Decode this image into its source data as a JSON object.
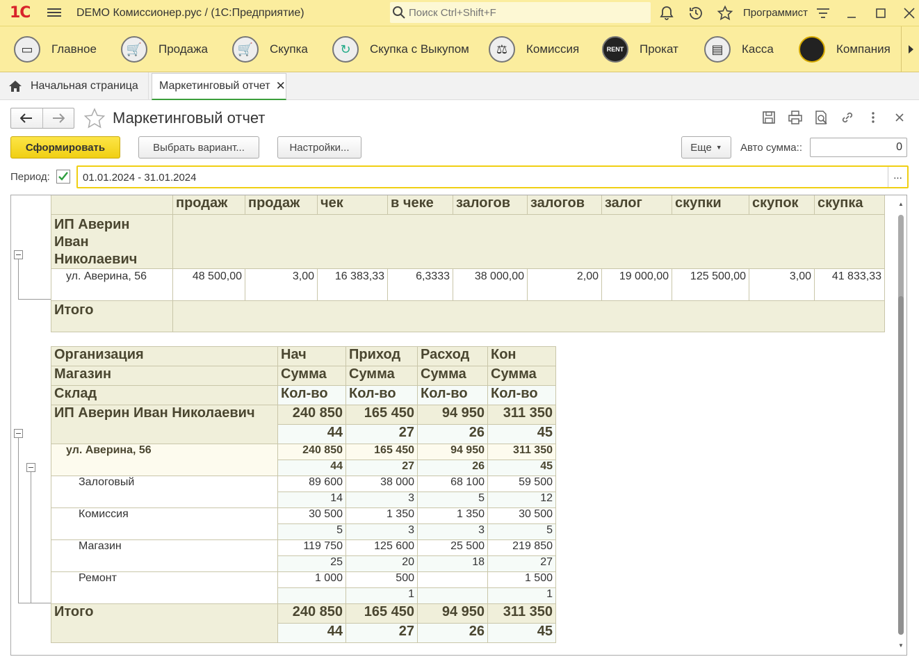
{
  "titlebar": {
    "logo": "1С",
    "app_title": "DEMO Комиссионер.рус /   (1С:Предприятие)",
    "search_placeholder": "Поиск Ctrl+Shift+F",
    "user": "Программист"
  },
  "sections": [
    {
      "label": "Главное",
      "icon": "main-icon"
    },
    {
      "label": "Продажа",
      "icon": "sale-cart-icon"
    },
    {
      "label": "Скупка",
      "icon": "purchase-cart-icon"
    },
    {
      "label": "Скупка с Выкупом",
      "icon": "buyback-arrows-icon"
    },
    {
      "label": "Комиссия",
      "icon": "scales-icon"
    },
    {
      "label": "Прокат",
      "icon": "rent-icon"
    },
    {
      "label": "Касса",
      "icon": "cash-register-icon"
    },
    {
      "label": "Компания",
      "icon": "company-logo-icon"
    }
  ],
  "tabs": {
    "home": "Начальная страница",
    "report": "Маркетинговый отчет"
  },
  "form": {
    "title": "Маркетинговый отчет",
    "generate": "Сформировать",
    "choose_variant": "Выбрать вариант...",
    "settings": "Настройки...",
    "more": "Еще",
    "auto_sum_label": "Авто сумма::",
    "auto_sum_value": "0",
    "period_label": "Период:",
    "period_value": "01.01.2024 - 31.01.2024",
    "period_dots": "..."
  },
  "table1": {
    "headers": [
      "продаж",
      "продаж",
      "чек",
      "в чеке",
      "залогов",
      "залогов",
      "залог",
      "скупки",
      "скупок",
      "скупка"
    ],
    "org_line1": "ИП Аверин",
    "org_line2": "Иван",
    "org_line3": "Николаевич",
    "store": "ул. Аверина, 56",
    "row": [
      "48 500,00",
      "3,00",
      "16 383,33",
      "6,3333",
      "38 000,00",
      "2,00",
      "19 000,00",
      "125 500,00",
      "3,00",
      "41 833,33"
    ],
    "total_label": "Итого"
  },
  "table2": {
    "h_org": "Организация",
    "h_store": "Магазин",
    "h_wh": "Склад",
    "h_cols": [
      "Нач",
      "Приход",
      "Расход",
      "Кон"
    ],
    "h_sum": "Сумма",
    "h_qty": "Кол-во",
    "org": "ИП Аверин Иван Николаевич",
    "org_sum": [
      "240 850",
      "165 450",
      "94 950",
      "311 350"
    ],
    "org_qty": [
      "44",
      "27",
      "26",
      "45"
    ],
    "store": "ул. Аверина, 56",
    "store_sum": [
      "240 850",
      "165 450",
      "94 950",
      "311 350"
    ],
    "store_qty": [
      "44",
      "27",
      "26",
      "45"
    ],
    "rows": [
      {
        "name": "Залоговый",
        "sum": [
          "89 600",
          "38 000",
          "68 100",
          "59 500"
        ],
        "qty": [
          "14",
          "3",
          "5",
          "12"
        ]
      },
      {
        "name": "Комиссия",
        "sum": [
          "30 500",
          "1 350",
          "1 350",
          "30 500"
        ],
        "qty": [
          "5",
          "3",
          "3",
          "5"
        ]
      },
      {
        "name": "Магазин",
        "sum": [
          "119 750",
          "125 600",
          "25 500",
          "219 850"
        ],
        "qty": [
          "25",
          "20",
          "18",
          "27"
        ]
      },
      {
        "name": "Ремонт",
        "sum": [
          "1 000",
          "500",
          "",
          "1 500"
        ],
        "qty": [
          "",
          "1",
          "",
          "1"
        ]
      }
    ],
    "total_label": "Итого",
    "total_sum": [
      "240 850",
      "165 450",
      "94 950",
      "311 350"
    ],
    "total_qty": [
      "44",
      "27",
      "26",
      "45"
    ]
  },
  "colors": {
    "accent_yellow": "#fbed9e",
    "button_yellow": "#f0cf13",
    "header_bg": "#f0efda",
    "tab_active_line": "#3a9e3a"
  }
}
